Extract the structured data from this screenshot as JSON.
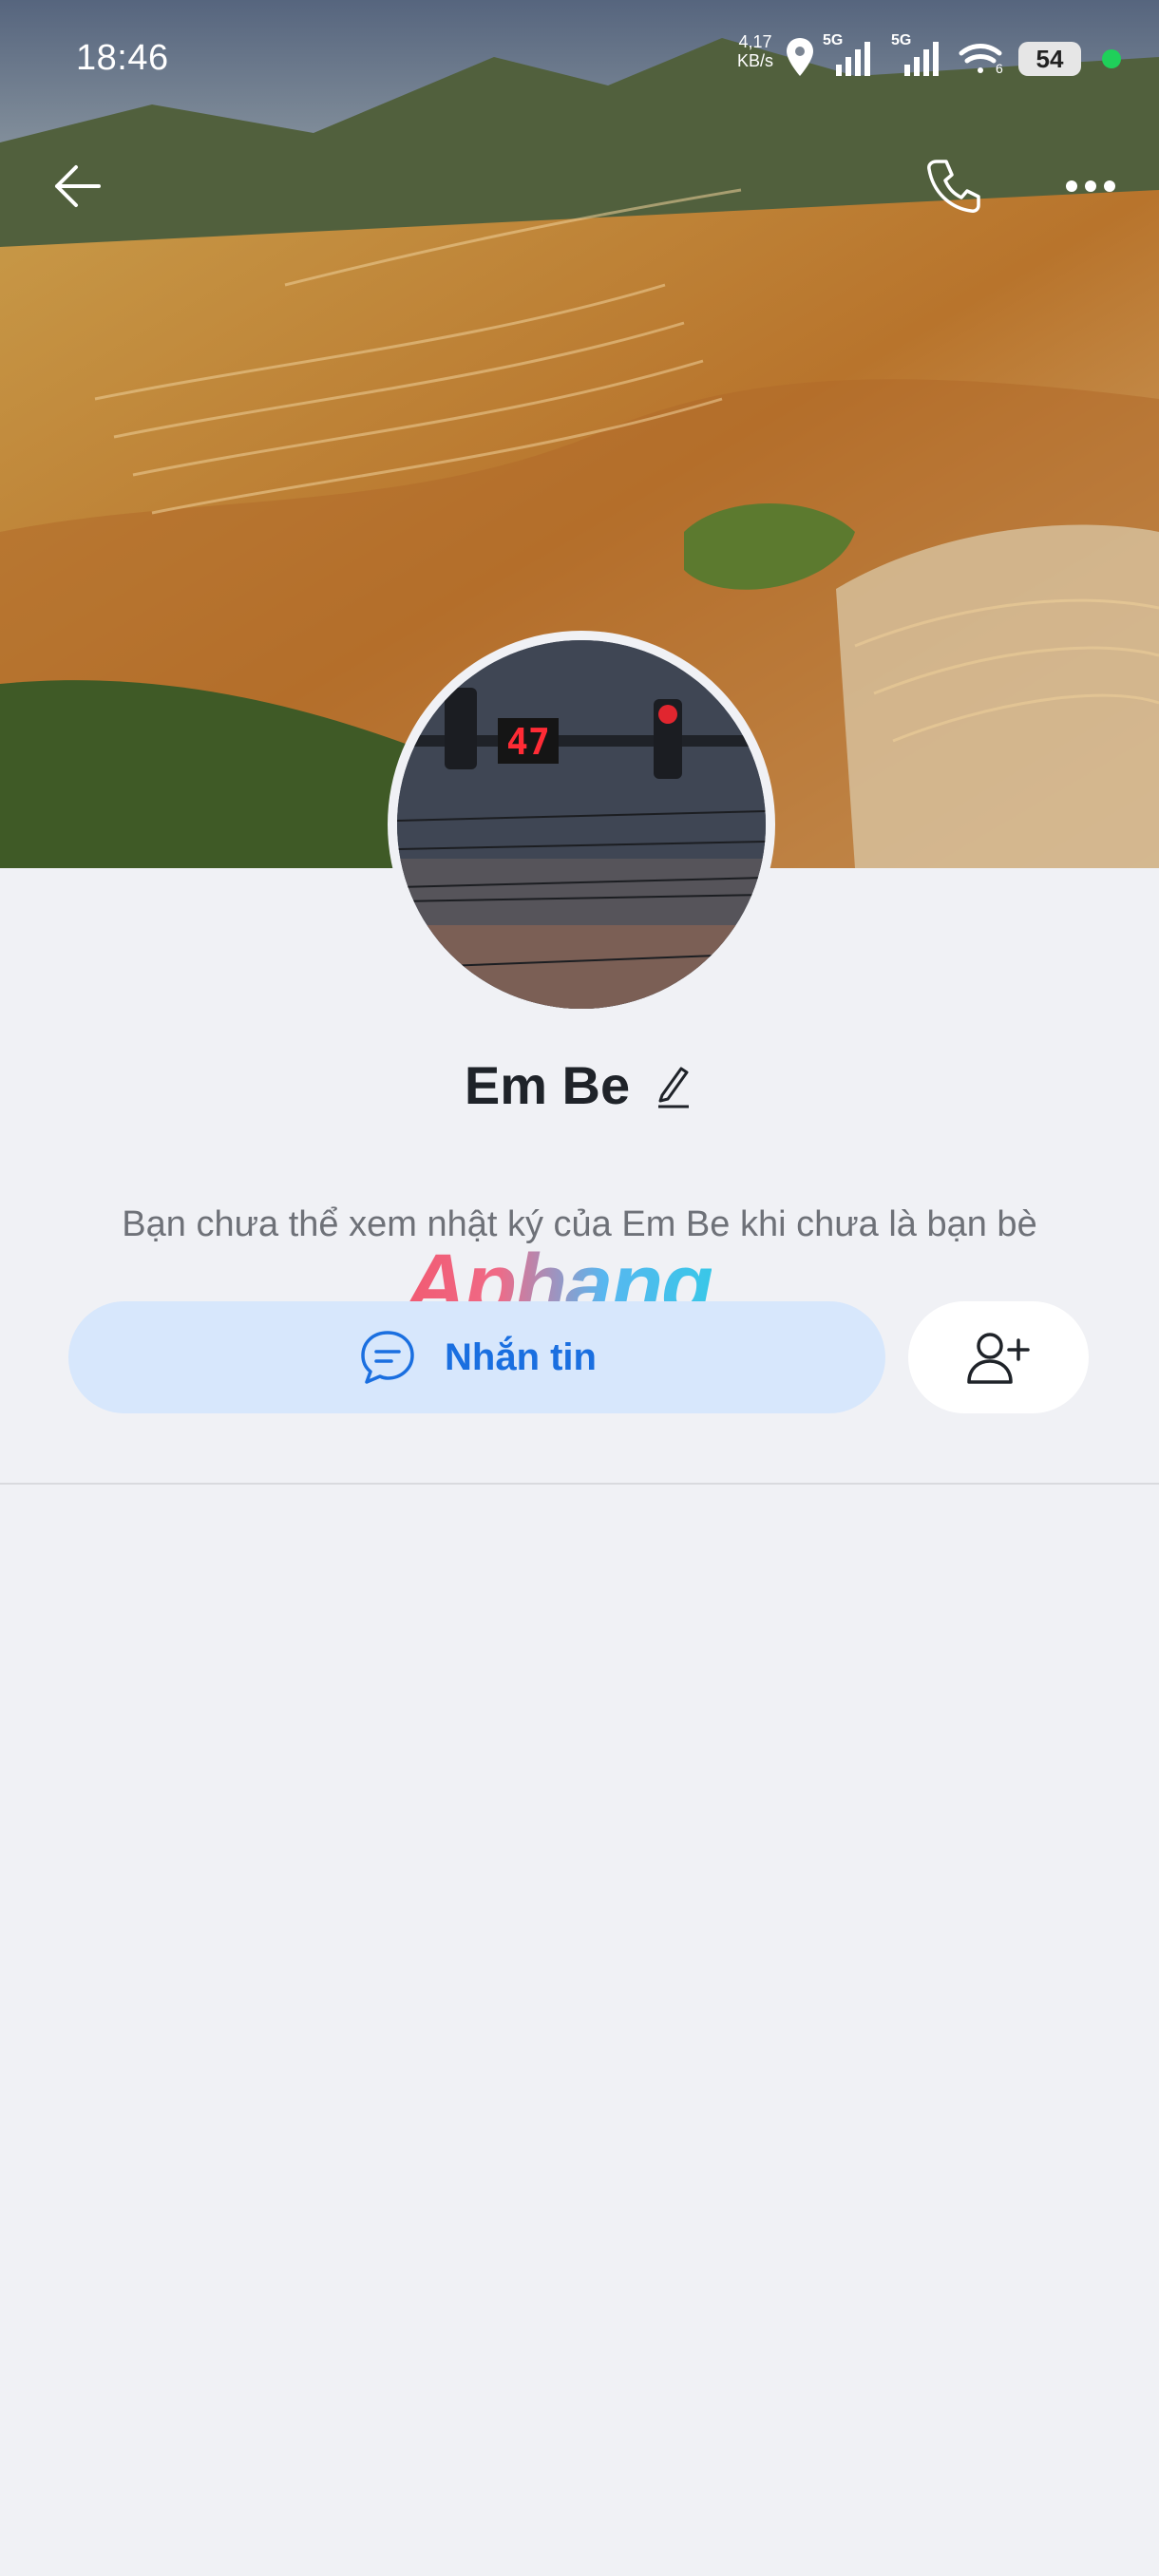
{
  "status_bar": {
    "time": "18:46",
    "net_speed_value": "4,17",
    "net_speed_unit": "KB/s",
    "signal1_label": "5G",
    "signal2_label": "5G",
    "wifi_label": "6",
    "battery": "54"
  },
  "header": {
    "back_icon": "arrow-left-icon",
    "call_icon": "phone-icon",
    "more_icon": "more-dots-icon"
  },
  "profile": {
    "name": "Em Be",
    "avatar_counter": "47",
    "notice": "Bạn chưa thể xem nhật ký của Em Be khi chưa là bạn bè"
  },
  "watermark": "Aphang",
  "actions": {
    "message_label": "Nhắn tin",
    "message_icon": "chat-bubble-icon",
    "add_friend_icon": "add-user-icon"
  },
  "colors": {
    "accent": "#1a6fe0",
    "message_button_bg": "#d7e7fc",
    "page_bg": "#f0f1f5"
  }
}
